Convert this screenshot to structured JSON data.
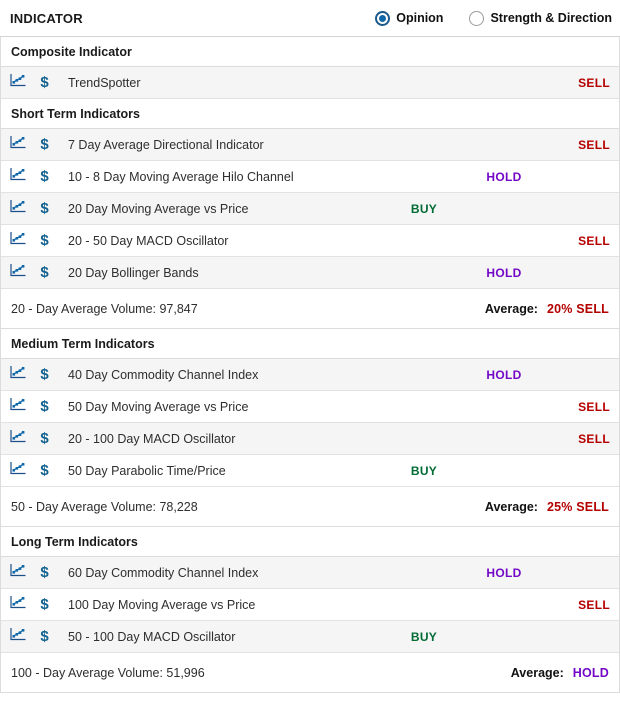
{
  "header": {
    "title": "INDICATOR",
    "view_modes": [
      {
        "label": "Opinion",
        "selected": true
      },
      {
        "label": "Strength & Direction",
        "selected": false
      }
    ]
  },
  "icons": {
    "chart": "line-chart-icon",
    "dollar": "$"
  },
  "colors": {
    "buy": "#006b33",
    "hold": "#7308c6",
    "sell": "#b50000",
    "radio_selected": "#1068a8"
  },
  "sections": [
    {
      "title": "Composite Indicator",
      "rows": [
        {
          "name": "TrendSpotter",
          "verdict": "SELL"
        }
      ]
    },
    {
      "title": "Short Term Indicators",
      "rows": [
        {
          "name": "7 Day Average Directional Indicator",
          "verdict": "SELL"
        },
        {
          "name": "10 - 8 Day Moving Average Hilo Channel",
          "verdict": "HOLD"
        },
        {
          "name": "20 Day Moving Average vs Price",
          "verdict": "BUY"
        },
        {
          "name": "20 - 50 Day MACD Oscillator",
          "verdict": "SELL"
        },
        {
          "name": "20 Day Bollinger Bands",
          "verdict": "HOLD"
        }
      ],
      "summary": {
        "volume_label": "20 - Day Average Volume: 97,847",
        "average_label": "Average:",
        "average_value": "20% SELL",
        "average_verdict": "SELL"
      }
    },
    {
      "title": "Medium Term Indicators",
      "rows": [
        {
          "name": "40 Day Commodity Channel Index",
          "verdict": "HOLD"
        },
        {
          "name": "50 Day Moving Average vs Price",
          "verdict": "SELL"
        },
        {
          "name": "20 - 100 Day MACD Oscillator",
          "verdict": "SELL"
        },
        {
          "name": "50 Day Parabolic Time/Price",
          "verdict": "BUY"
        }
      ],
      "summary": {
        "volume_label": "50 - Day Average Volume: 78,228",
        "average_label": "Average:",
        "average_value": "25% SELL",
        "average_verdict": "SELL"
      }
    },
    {
      "title": "Long Term Indicators",
      "rows": [
        {
          "name": "60 Day Commodity Channel Index",
          "verdict": "HOLD"
        },
        {
          "name": "100 Day Moving Average vs Price",
          "verdict": "SELL"
        },
        {
          "name": "50 - 100 Day MACD Oscillator",
          "verdict": "BUY"
        }
      ],
      "summary": {
        "volume_label": "100 - Day Average Volume: 51,996",
        "average_label": "Average:",
        "average_value": "HOLD",
        "average_verdict": "HOLD"
      }
    }
  ]
}
